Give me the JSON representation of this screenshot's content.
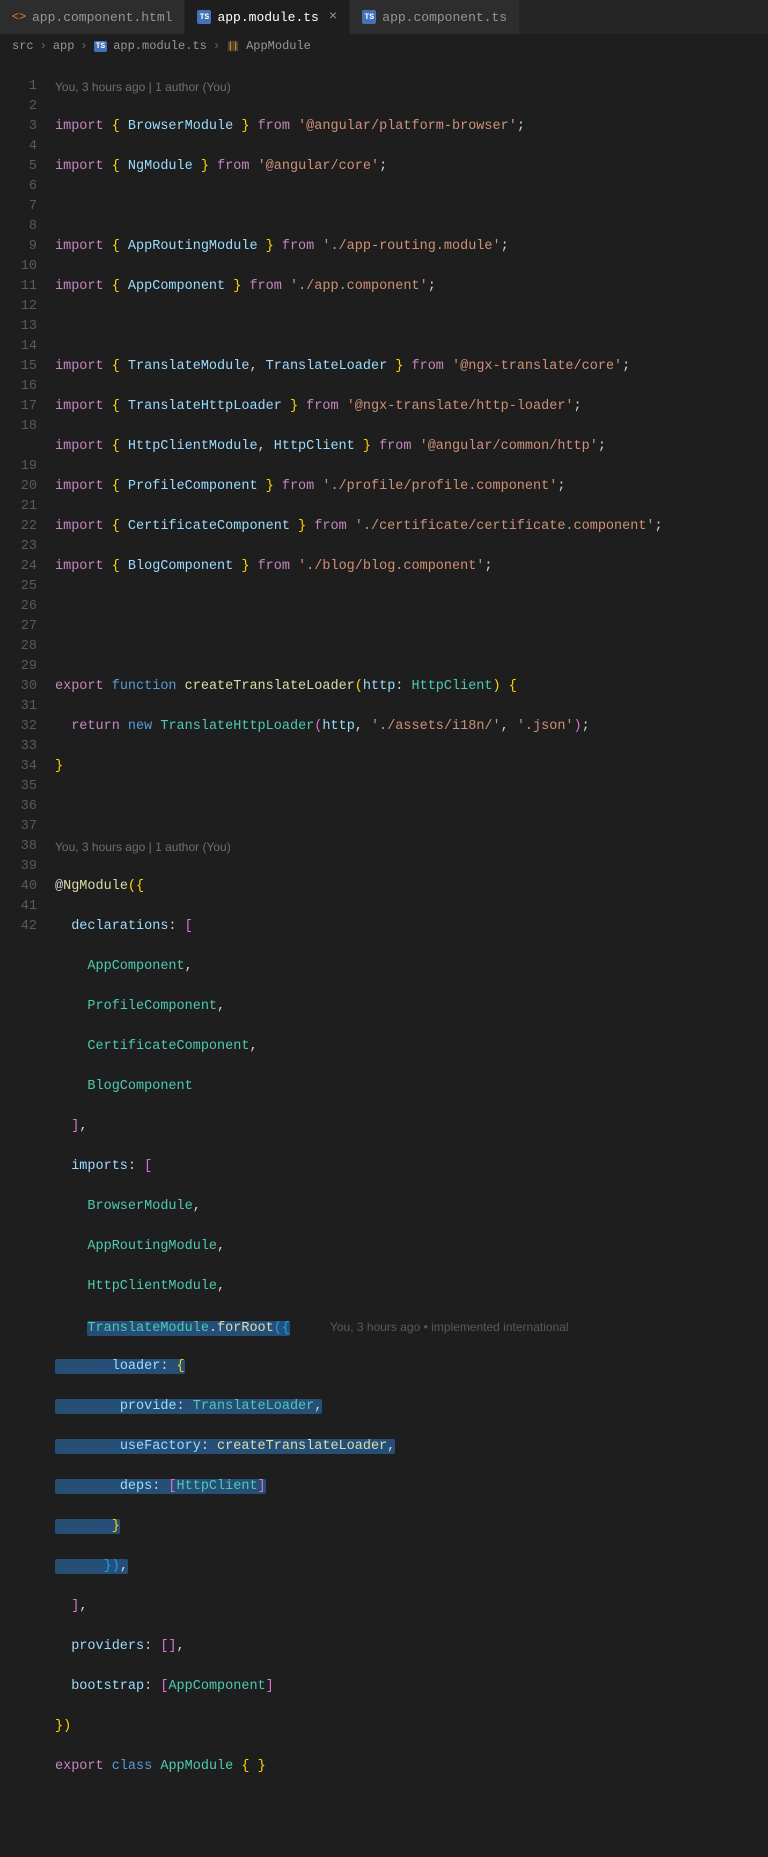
{
  "tabs": [
    {
      "icon": "html",
      "label": "app.component.html"
    },
    {
      "icon": "ts",
      "label": "app.module.ts",
      "active": true
    },
    {
      "icon": "ts",
      "label": "app.component.ts"
    }
  ],
  "breadcrumb": {
    "parts": [
      "src",
      "app",
      "app.module.ts",
      "AppModule"
    ],
    "sep": "›",
    "ts_badge": "TS"
  },
  "lens1": "You, 3 hours ago | 1 author (You)",
  "lens2": "You, 3 hours ago | 1 author (You)",
  "inline_lens": "You, 3 hours ago • implemented international",
  "lines": {
    "l1": {
      "import": "import",
      "open": "{ ",
      "name": "BrowserModule",
      "close": " }",
      "from": "from",
      "path": "'@angular/platform-browser'"
    },
    "l2": {
      "import": "import",
      "open": "{ ",
      "name": "NgModule",
      "close": " }",
      "from": "from",
      "path": "'@angular/core'"
    },
    "l4": {
      "import": "import",
      "open": "{ ",
      "name": "AppRoutingModule",
      "close": " }",
      "from": "from",
      "path": "'./app-routing.module'"
    },
    "l5": {
      "import": "import",
      "open": "{ ",
      "name": "AppComponent",
      "close": " }",
      "from": "from",
      "path": "'./app.component'"
    },
    "l7": {
      "import": "import",
      "open": "{ ",
      "n1": "TranslateModule",
      "comma": ", ",
      "n2": "TranslateLoader",
      "close": " }",
      "from": "from",
      "path": "'@ngx-translate/core'"
    },
    "l8": {
      "import": "import",
      "open": "{ ",
      "name": "TranslateHttpLoader",
      "close": " }",
      "from": "from",
      "path": "'@ngx-translate/http-loader'"
    },
    "l9": {
      "import": "import",
      "open": "{ ",
      "n1": "HttpClientModule",
      "comma": ", ",
      "n2": "HttpClient",
      "close": " }",
      "from": "from",
      "path": "'@angular/common/http'"
    },
    "l10": {
      "import": "import",
      "open": "{ ",
      "name": "ProfileComponent",
      "close": " }",
      "from": "from",
      "path": "'./profile/profile.component'"
    },
    "l11": {
      "import": "import",
      "open": "{ ",
      "name": "CertificateComponent",
      "close": " }",
      "from": "from",
      "path": "'./certificate/certificate.component'"
    },
    "l12": {
      "import": "import",
      "open": "{ ",
      "name": "BlogComponent",
      "close": " }",
      "from": "from",
      "path": "'./blog/blog.component'"
    },
    "l15": {
      "export": "export",
      "function": "function",
      "fnname": "createTranslateLoader",
      "param": "http",
      "ptype": "HttpClient"
    },
    "l16": {
      "return": "return",
      "new": "new",
      "ctor": "TranslateHttpLoader",
      "arg1": "http",
      "arg2": "'./assets/i18n/'",
      "arg3": "'.json'"
    },
    "l19": {
      "at": "@",
      "dec": "NgModule"
    },
    "l20": {
      "key": "declarations"
    },
    "l21": "AppComponent",
    "l22": "ProfileComponent",
    "l23": "CertificateComponent",
    "l24": "BlogComponent",
    "l26": {
      "key": "imports"
    },
    "l27": "BrowserModule",
    "l28": "AppRoutingModule",
    "l29": "HttpClientModule",
    "l30": {
      "mod": "TranslateModule",
      "method": "forRoot"
    },
    "l31": {
      "key": "loader"
    },
    "l32": {
      "key": "provide",
      "val": "TranslateLoader"
    },
    "l33": {
      "key": "useFactory",
      "val": "createTranslateLoader"
    },
    "l34": {
      "key": "deps",
      "val": "HttpClient"
    },
    "l38": {
      "key": "providers"
    },
    "l39": {
      "key": "bootstrap",
      "val": "AppComponent"
    },
    "l41": {
      "export": "export",
      "class": "class",
      "name": "AppModule"
    }
  }
}
